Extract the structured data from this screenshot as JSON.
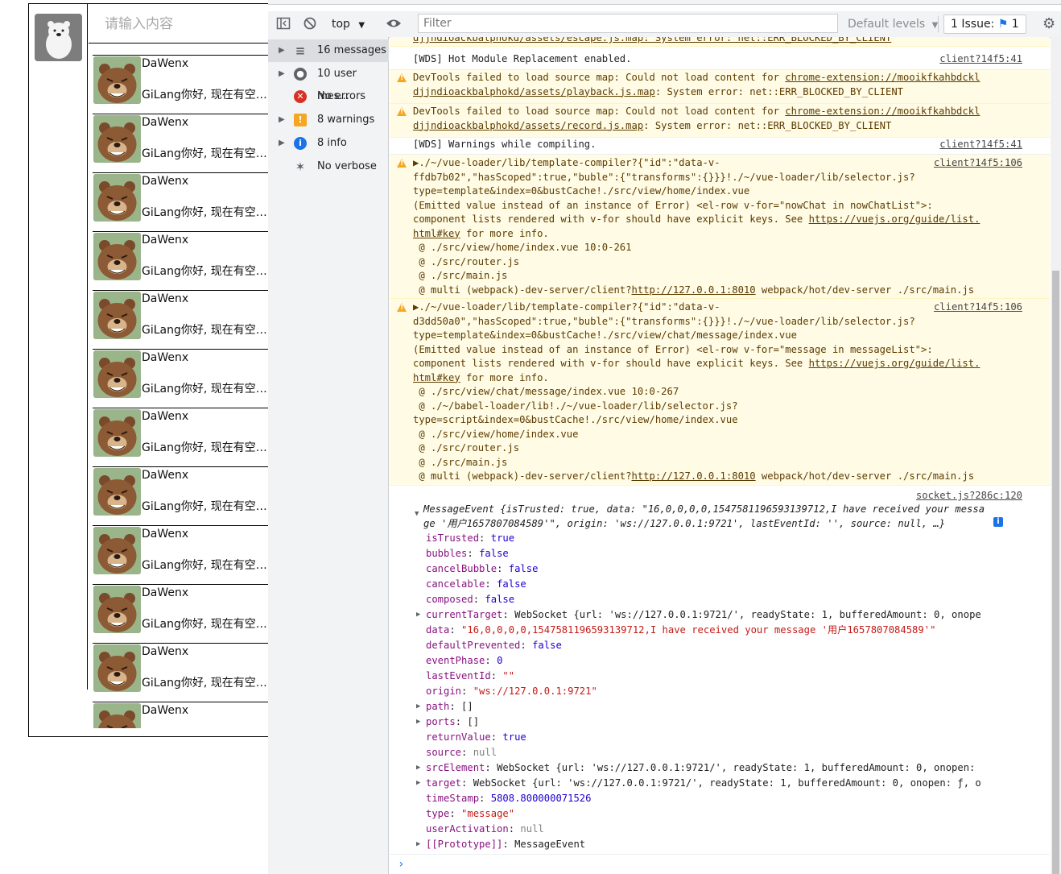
{
  "app": {
    "search": {
      "placeholder": "请输入内容",
      "value": ""
    },
    "chats": [
      {
        "name": "DaWenx",
        "last_message": "GiLang你好, 现在有空?能..."
      },
      {
        "name": "DaWenx",
        "last_message": "GiLang你好, 现在有空?能..."
      },
      {
        "name": "DaWenx",
        "last_message": "GiLang你好, 现在有空?能..."
      },
      {
        "name": "DaWenx",
        "last_message": "GiLang你好, 现在有空?能..."
      },
      {
        "name": "DaWenx",
        "last_message": "GiLang你好, 现在有空?能..."
      },
      {
        "name": "DaWenx",
        "last_message": "GiLang你好, 现在有空?能..."
      },
      {
        "name": "DaWenx",
        "last_message": "GiLang你好, 现在有空?能..."
      },
      {
        "name": "DaWenx",
        "last_message": "GiLang你好, 现在有空?能..."
      },
      {
        "name": "DaWenx",
        "last_message": "GiLang你好, 现在有空?能..."
      },
      {
        "name": "DaWenx",
        "last_message": "GiLang你好, 现在有空?能..."
      },
      {
        "name": "DaWenx",
        "last_message": "GiLang你好, 现在有空?能..."
      },
      {
        "name": "DaWenx",
        "last_message": ""
      }
    ]
  },
  "devtools": {
    "toolbar": {
      "context": "top",
      "filter_placeholder": "Filter",
      "levels": "Default levels",
      "issues": "1 Issue:",
      "issues_count": "1"
    },
    "sidebar": [
      {
        "label": "16 messages",
        "icon": "list-icon"
      },
      {
        "label": "10 user mes...",
        "icon": "user-icon"
      },
      {
        "label": "No errors",
        "icon": "error-icon"
      },
      {
        "label": "8 warnings",
        "icon": "warning-icon"
      },
      {
        "label": "8 info",
        "icon": "info-icon"
      },
      {
        "label": "No verbose",
        "icon": "bug-icon"
      }
    ],
    "messages": {
      "m0": "djjndioackbalphokd/assets/escape.js.map: System error: net::ERR_BLOCKED_BY_CLIENT",
      "m1_text": "[WDS] Hot Module Replacement enabled.",
      "m1_src": "client?14f5:41",
      "m2_l1a": "DevTools failed to load source map: Could not load content for ",
      "m2_l1b": "chrome-extension://mooikfkahbdckl",
      "m2_l2a": "djjndioackbalphokd/assets/playback.js.map",
      "m2_l2b": ": System error: net::ERR_BLOCKED_BY_CLIENT",
      "m3_l1a": "DevTools failed to load source map: Could not load content for ",
      "m3_l1b": "chrome-extension://mooikfkahbdckl",
      "m3_l2a": "djjndioackbalphokd/assets/record.js.map",
      "m3_l2b": ": System error: net::ERR_BLOCKED_BY_CLIENT",
      "m4_text": "[WDS] Warnings while compiling.",
      "m4_src": "client?14f5:41",
      "w1": [
        "▶./~/vue-loader/lib/template-compiler?{\"id\":\"data-v-",
        "ffdb7b02\",\"hasScoped\":true,\"buble\":{\"transforms\":{}}}!./~/vue-loader/lib/selector.js?",
        "type=template&index=0&bustCache!./src/view/home/index.vue",
        "(Emitted value instead of an instance of Error) <el-row v-for=\"nowChat in nowChatList\">:",
        "component lists rendered with v-for should have explicit keys. See ",
        "https://vuejs.org/guide/list.",
        "html#key",
        " for more info.",
        " @ ./src/view/home/index.vue 10:0-261",
        " @ ./src/router.js",
        " @ ./src/main.js",
        " @ multi (webpack)-dev-server/client?",
        "http://127.0.0.1:8010",
        " webpack/hot/dev-server ./src/main.js"
      ],
      "w1_src": "client?14f5:106",
      "w2": [
        "▶./~/vue-loader/lib/template-compiler?{\"id\":\"data-v-",
        "d3dd50a0\",\"hasScoped\":true,\"buble\":{\"transforms\":{}}}!./~/vue-loader/lib/selector.js?",
        "type=template&index=0&bustCache!./src/view/chat/message/index.vue",
        "(Emitted value instead of an instance of Error) <el-row v-for=\"message in messageList\">:",
        "component lists rendered with v-for should have explicit keys. See ",
        "https://vuejs.org/guide/list.",
        "html#key",
        " for more info.",
        " @ ./src/view/chat/message/index.vue 10:0-267",
        " @ ./~/babel-loader/lib!./~/vue-loader/lib/selector.js?",
        "type=script&index=0&bustCache!./src/view/home/index.vue",
        " @ ./src/view/home/index.vue",
        " @ ./src/router.js",
        " @ ./src/main.js",
        " @ multi (webpack)-dev-server/client?",
        "http://127.0.0.1:8010",
        " webpack/hot/dev-server ./src/main.js"
      ],
      "w2_src": "client?14f5:106",
      "ev_src": "socket.js?286c:120",
      "ev_head1": "MessageEvent {isTrusted: true, data: \"16,0,0,0,0,1547581196593139712,I have received your messa",
      "ev_head2": "ge '用户1657807084589'\", origin: 'ws://127.0.0.1:9721', lastEventId: '', source: null, …}",
      "props": [
        {
          "k": "isTrusted",
          "v": "true",
          "t": "n"
        },
        {
          "k": "bubbles",
          "v": "false",
          "t": "n"
        },
        {
          "k": "cancelBubble",
          "v": "false",
          "t": "n"
        },
        {
          "k": "cancelable",
          "v": "false",
          "t": "n"
        },
        {
          "k": "composed",
          "v": "false",
          "t": "n"
        },
        {
          "k": "currentTarget",
          "v": "WebSocket {url: 'ws://127.0.0.1:9721/', readyState: 1, bufferedAmount: 0, onope",
          "t": "o"
        },
        {
          "k": "data",
          "v": "\"16,0,0,0,0,1547581196593139712,I have received your message '用户1657807084589'\"",
          "t": "s"
        },
        {
          "k": "defaultPrevented",
          "v": "false",
          "t": "n"
        },
        {
          "k": "eventPhase",
          "v": "0",
          "t": "n"
        },
        {
          "k": "lastEventId",
          "v": "\"\"",
          "t": "s"
        },
        {
          "k": "origin",
          "v": "\"ws://127.0.0.1:9721\"",
          "t": "s"
        },
        {
          "k": "path",
          "v": "[]",
          "t": "o"
        },
        {
          "k": "ports",
          "v": "[]",
          "t": "o"
        },
        {
          "k": "returnValue",
          "v": "true",
          "t": "n"
        },
        {
          "k": "source",
          "v": "null",
          "t": "g"
        },
        {
          "k": "srcElement",
          "v": "WebSocket {url: 'ws://127.0.0.1:9721/', readyState: 1, bufferedAmount: 0, onopen:",
          "t": "o"
        },
        {
          "k": "target",
          "v": "WebSocket {url: 'ws://127.0.0.1:9721/', readyState: 1, bufferedAmount: 0, onopen: ƒ, o",
          "t": "o"
        },
        {
          "k": "timeStamp",
          "v": "5808.800000071526",
          "t": "n"
        },
        {
          "k": "type",
          "v": "\"message\"",
          "t": "s"
        },
        {
          "k": "userActivation",
          "v": "null",
          "t": "g"
        },
        {
          "k": "[[Prototype]]",
          "v": "MessageEvent",
          "t": "o"
        }
      ]
    }
  }
}
